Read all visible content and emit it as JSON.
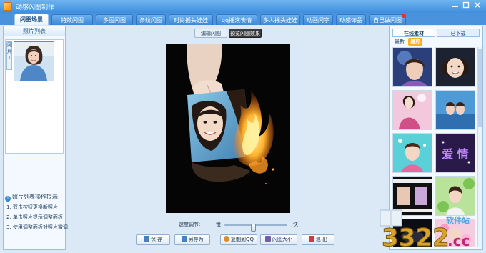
{
  "app": {
    "title": "动感闪图制作"
  },
  "tabs": [
    {
      "label": "闪图场景",
      "active": true
    },
    {
      "label": "特效闪图",
      "active": false
    },
    {
      "label": "多图闪图",
      "active": false
    },
    {
      "label": "条纹闪图",
      "active": false
    },
    {
      "label": "时尚摇头娃娃",
      "active": false
    },
    {
      "label": "qq摇滚表情",
      "active": false
    },
    {
      "label": "多人摇头娃娃",
      "active": false
    },
    {
      "label": "动画闪字",
      "active": false
    },
    {
      "label": "动感饰品",
      "active": false
    },
    {
      "label": "自己做闪图",
      "active": false
    }
  ],
  "left_panel": {
    "title": "照片列表",
    "thumb_index_label": "照片1",
    "tips_title": "照片列表操作提示:",
    "tips": [
      "1. 双击按钮更换新照片",
      "2. 单击照片提示调整面板",
      "3. 使用调整面板对照片微调"
    ]
  },
  "center": {
    "mode_tabs": [
      {
        "label": "编辑闪图",
        "active": false
      },
      {
        "label": "预览闪图效果",
        "active": true
      }
    ],
    "speed": {
      "label": "速度调节:",
      "slow": "慢",
      "fast": "快",
      "value": 0.45
    }
  },
  "actions": [
    {
      "label": "保 存",
      "color": "#4a7fc1"
    },
    {
      "label": "另存为",
      "color": "#4a7fc1"
    },
    {
      "label": "复制到QQ",
      "color": "#e08a2a"
    },
    {
      "label": "闪图大小",
      "color": "#6f5fb3"
    },
    {
      "label": "退 出",
      "color": "#d23a3a"
    }
  ],
  "right_panel": {
    "tabs": [
      {
        "label": "在线素材",
        "active": true
      },
      {
        "label": "已下载",
        "active": false
      }
    ],
    "subtabs": [
      {
        "label": "最新",
        "active": false
      },
      {
        "label": "最热",
        "active": true
      }
    ],
    "thumbnails": [
      "portrait-blue",
      "portrait-smile",
      "woman-pink",
      "couple-blue",
      "child-teal",
      "love-text",
      "filmstrip-dark",
      "girl-green",
      "dark-scene",
      "flowers-pink"
    ],
    "love_text": "爱 情"
  },
  "colors": {
    "titlebar": "#4a93dc",
    "accent": "#f7b21c",
    "fire": "#ff8a1c"
  },
  "watermark": {
    "text_main": "3322",
    "text_site": "软件站",
    "text_tld": ".cc"
  }
}
